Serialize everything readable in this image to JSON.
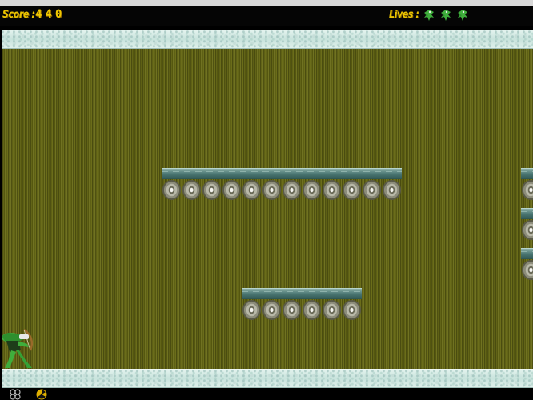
{
  "hud": {
    "score_label": "Score :",
    "score_value": "440",
    "lives_label": "Lives :",
    "lives_count": 3,
    "life_icon": "green-creature-icon"
  },
  "platforms": [
    {
      "name": "upper-platform",
      "wheel_count": 12
    },
    {
      "name": "lower-platform",
      "wheel_count": 6
    },
    {
      "name": "right-edge-platform",
      "wheel_count": 3
    }
  ],
  "player": {
    "icon": "green-archer-icon"
  },
  "bottom_items": [
    {
      "icon": "rings-icon"
    },
    {
      "icon": "radiation-icon"
    }
  ],
  "colors": {
    "hud_text": "#e8c200",
    "playfield": "#5b5d14",
    "marble": "#d4ece6",
    "platform_top": "#4e7a76"
  }
}
